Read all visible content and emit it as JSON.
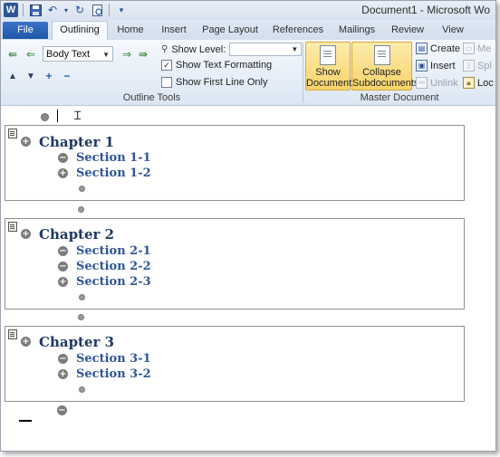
{
  "window": {
    "title": "Document1 - Microsoft Wo"
  },
  "qat": {
    "logo": "W",
    "save_icon": "floppy-icon",
    "undo_icon": "undo-icon",
    "redo_icon": "redo-icon",
    "print_icon": "print-preview-icon",
    "customize_icon": "dropdown-icon"
  },
  "tabs": [
    {
      "label": "File"
    },
    {
      "label": "Outlining"
    },
    {
      "label": "Home"
    },
    {
      "label": "Insert"
    },
    {
      "label": "Page Layout"
    },
    {
      "label": "References"
    },
    {
      "label": "Mailings"
    },
    {
      "label": "Review"
    },
    {
      "label": "View"
    }
  ],
  "outline_tools": {
    "group_label": "Outline Tools",
    "level_value": "Body Text",
    "show_level_label": "Show Level:",
    "show_level_value": "",
    "show_text_formatting": {
      "label": "Show Text Formatting",
      "checked": true
    },
    "show_first_line_only": {
      "label": "Show First Line Only",
      "checked": false
    }
  },
  "master_document": {
    "group_label": "Master Document",
    "show_document": "Show Document",
    "collapse_subdocuments": "Collapse Subdocuments",
    "create": "Create",
    "insert": "Insert",
    "unlink": "Unlink",
    "merge": "Me",
    "split": "Spl",
    "lock": "Loc"
  },
  "document": {
    "chapters": [
      {
        "title": "Chapter 1",
        "sections": [
          {
            "label": "Section 1-1",
            "expanded": false
          },
          {
            "label": "Section 1-2",
            "expanded": true
          }
        ]
      },
      {
        "title": "Chapter 2",
        "sections": [
          {
            "label": "Section 2-1",
            "expanded": false
          },
          {
            "label": "Section 2-2",
            "expanded": false
          },
          {
            "label": "Section 2-3",
            "expanded": true
          }
        ]
      },
      {
        "title": "Chapter 3",
        "sections": [
          {
            "label": "Section 3-1",
            "expanded": false
          },
          {
            "label": "Section 3-2",
            "expanded": true
          }
        ]
      }
    ]
  }
}
